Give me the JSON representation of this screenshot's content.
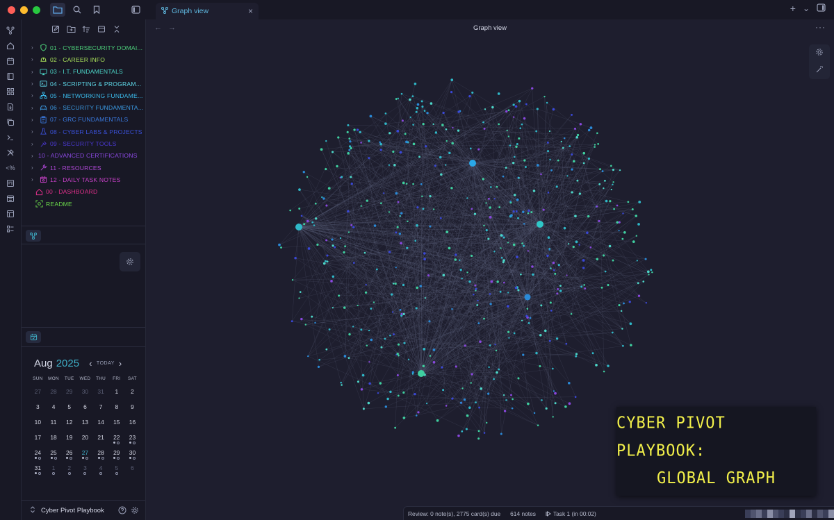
{
  "window": {
    "traffic_lights": [
      "#ff5f57",
      "#febc2e",
      "#28c840"
    ]
  },
  "tab": {
    "label": "Graph view",
    "close": "×"
  },
  "tab_actions": {
    "new_tab": "+",
    "tab_list": "⌄"
  },
  "view": {
    "title": "Graph view",
    "back": "←",
    "forward": "→",
    "more": "···"
  },
  "file_tree": [
    {
      "label": "01 - CYBERSECURITY DOMAI...",
      "color": "#4cd07a",
      "icon": "shield-icon",
      "folder": true
    },
    {
      "label": "02 - CAREER INFO",
      "color": "#a8e05a",
      "icon": "hardhat-icon",
      "folder": true
    },
    {
      "label": "03 - I.T. FUNDAMENTALS",
      "color": "#4cd6c8",
      "icon": "monitor-icon",
      "folder": true
    },
    {
      "label": "04 - SCRIPTING & PROGRAM...",
      "color": "#5ed8e8",
      "icon": "terminal-icon",
      "folder": true
    },
    {
      "label": "05 - NETWORKING FUNDAME...",
      "color": "#3ab8e8",
      "icon": "network-icon",
      "folder": true
    },
    {
      "label": "06 - SECURITY FUNDAMENTA...",
      "color": "#3a98e0",
      "icon": "car-icon",
      "folder": true
    },
    {
      "label": "07 - GRC FUNDAMENTALS",
      "color": "#3a7ae0",
      "icon": "clipboard-icon",
      "folder": true
    },
    {
      "label": "08 - CYBER LABS & PROJECTS",
      "color": "#3a50d8",
      "icon": "flask-icon",
      "folder": true
    },
    {
      "label": "09 - SECURITY TOOLS",
      "color": "#4a38d0",
      "icon": "tool-icon",
      "folder": true
    },
    {
      "label": "10 - ADVANCED CERTIFICATIONS",
      "color": "#8a48e0",
      "icon": "",
      "folder": true
    },
    {
      "label": "11 - RESOURCES",
      "color": "#b048d8",
      "icon": "wrench-icon",
      "folder": true
    },
    {
      "label": "12 - DAILY TASK NOTES",
      "color": "#c840c8",
      "icon": "calendar-icon",
      "folder": true
    },
    {
      "label": "00 - DASHBOARD",
      "color": "#e0308a",
      "icon": "home-icon",
      "folder": false
    },
    {
      "label": "README",
      "color": "#6ad84a",
      "icon": "scan-icon",
      "folder": false
    }
  ],
  "calendar": {
    "month": "Aug",
    "year": "2025",
    "today_label": "TODAY",
    "weekdays": [
      "SUN",
      "MON",
      "TUE",
      "WED",
      "THU",
      "FRI",
      "SAT"
    ],
    "days": [
      {
        "d": "27",
        "m": true
      },
      {
        "d": "28",
        "m": true
      },
      {
        "d": "29",
        "m": true
      },
      {
        "d": "30",
        "m": true
      },
      {
        "d": "31",
        "m": true
      },
      {
        "d": "1"
      },
      {
        "d": "2"
      },
      {
        "d": "3"
      },
      {
        "d": "4"
      },
      {
        "d": "5"
      },
      {
        "d": "6"
      },
      {
        "d": "7"
      },
      {
        "d": "8"
      },
      {
        "d": "9"
      },
      {
        "d": "10"
      },
      {
        "d": "11"
      },
      {
        "d": "12"
      },
      {
        "d": "13"
      },
      {
        "d": "14"
      },
      {
        "d": "15"
      },
      {
        "d": "16"
      },
      {
        "d": "17"
      },
      {
        "d": "18"
      },
      {
        "d": "19"
      },
      {
        "d": "20"
      },
      {
        "d": "21"
      },
      {
        "d": "22",
        "dots": "fo"
      },
      {
        "d": "23",
        "dots": "fo"
      },
      {
        "d": "24",
        "dots": "fo"
      },
      {
        "d": "25",
        "dots": "fo"
      },
      {
        "d": "26",
        "dots": "fo"
      },
      {
        "d": "27",
        "today": true,
        "dots": "fo"
      },
      {
        "d": "28",
        "dots": "fo"
      },
      {
        "d": "29",
        "dots": "fo"
      },
      {
        "d": "30",
        "dots": "fo"
      },
      {
        "d": "31",
        "dots": "fo"
      },
      {
        "d": "1",
        "m": true,
        "dots": "o"
      },
      {
        "d": "2",
        "m": true,
        "dots": "o"
      },
      {
        "d": "3",
        "m": true,
        "dots": "o"
      },
      {
        "d": "4",
        "m": true,
        "dots": "o"
      },
      {
        "d": "5",
        "m": true,
        "dots": "o"
      },
      {
        "d": "6",
        "m": true
      }
    ]
  },
  "vault": {
    "name": "Cyber Pivot Playbook"
  },
  "overlay": {
    "line1": "CYBER PIVOT PLAYBOOK:",
    "line2": "GLOBAL GRAPH"
  },
  "status": {
    "review": "Review: 0 note(s), 2775 card(s) due",
    "notes": "614 notes",
    "task": "Task 1 (in 00:02)"
  }
}
